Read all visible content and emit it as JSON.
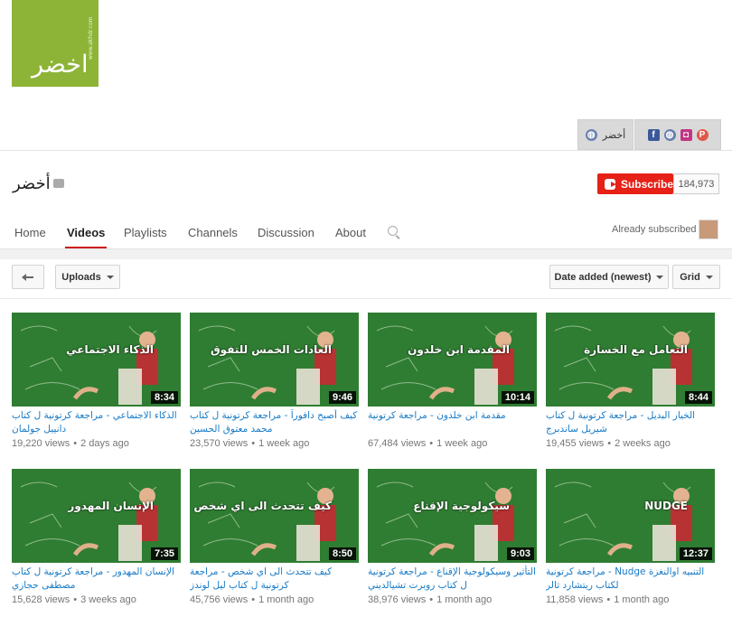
{
  "channel": {
    "logo_text": "اخضر",
    "logo_url_text": "www.akhdr.com",
    "name": "أخضر",
    "subscribe_label": "Subscribe",
    "subscriber_count": "184,973",
    "already_subscribed": "Already subscribed"
  },
  "banner_links": {
    "site_label": "أخضر",
    "icons": [
      "globe-icon",
      "facebook-icon",
      "globe-icon",
      "instagram-icon",
      "periscope-icon"
    ]
  },
  "tabs": [
    {
      "label": "Home",
      "active": false
    },
    {
      "label": "Videos",
      "active": true
    },
    {
      "label": "Playlists",
      "active": false
    },
    {
      "label": "Channels",
      "active": false
    },
    {
      "label": "Discussion",
      "active": false
    },
    {
      "label": "About",
      "active": false
    }
  ],
  "toolbar": {
    "uploads_label": "Uploads",
    "sort_label": "Date added (newest)",
    "view_label": "Grid"
  },
  "videos": [
    {
      "thumb_text": "الذكاء الاجتماعي",
      "duration": "8:34",
      "title": "الذكاء الاجتماعي - مراجعة كرتونية ل كتاب دانييل جولمان",
      "views": "19,220 views",
      "age": "2 days ago"
    },
    {
      "thumb_text": "العادات الخمس للتفوق",
      "duration": "9:46",
      "title": "كيف أصبح دافوراً - مراجعة كرتونية ل كتاب محمد معتوق الحسين",
      "views": "23,570 views",
      "age": "1 week ago"
    },
    {
      "thumb_text": "المقدمة ابن خلدون",
      "duration": "10:14",
      "title": "مقدمة ابن خلدون - مراجعة كرتونية",
      "views": "67,484 views",
      "age": "1 week ago"
    },
    {
      "thumb_text": "التعامل مع الخسارة",
      "duration": "8:44",
      "title": "الخيار البديل - مراجعة كرتونية ل كتاب شيريل ساندبرج",
      "views": "19,455 views",
      "age": "2 weeks ago"
    },
    {
      "thumb_text": "الإنسان المهدور",
      "duration": "7:35",
      "title": "الإنسان المهدور - مراجعة كرتونية ل كتاب مصطفى حجازي",
      "views": "15,628 views",
      "age": "3 weeks ago"
    },
    {
      "thumb_text": "كيف تتحدث الى اي شخص",
      "duration": "8:50",
      "title": "كيف تتحدث الى اي شخص - مراجعة كرتونية ل كتاب ليل لوندز",
      "views": "45,756 views",
      "age": "1 month ago"
    },
    {
      "thumb_text": "سيكولوجية الإقناع",
      "duration": "9:03",
      "title": "التأثير وسيكولوجية الإقناع - مراجعة كرتونية ل كتاب روبرت تشيالديني",
      "views": "38,976 views",
      "age": "1 month ago"
    },
    {
      "thumb_text": "NUDGE",
      "duration": "12:37",
      "title": "التنبيه اوالنغزة Nudge - مراجعة كرتونية لكتاب ريتشارد ثالر",
      "views": "11,858 views",
      "age": "1 month ago"
    }
  ],
  "colors": {
    "accent": "#cc181e",
    "subscribe": "#e62117",
    "link": "#167ac6",
    "logo": "#8db437",
    "chalkboard": "#2f7d32"
  }
}
